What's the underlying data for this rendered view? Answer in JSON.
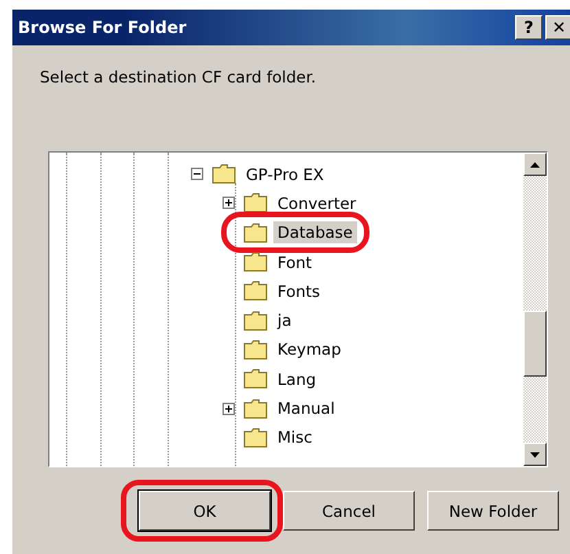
{
  "window": {
    "title": "Browse For Folder",
    "buttons": [
      "?",
      "✕"
    ]
  },
  "prompt": "Select a destination CF card folder.",
  "tree": [
    {
      "label": "GP-Pro EX",
      "has_children": true,
      "expanded": true,
      "selected": false,
      "highlighted": false,
      "children": [
        {
          "label": "Converter",
          "has_children": true,
          "expanded": false,
          "selected": false,
          "highlighted": false
        },
        {
          "label": "Database",
          "has_children": false,
          "expanded": false,
          "selected": true,
          "highlighted": true
        },
        {
          "label": "Font",
          "has_children": false,
          "expanded": false,
          "selected": false,
          "highlighted": false
        },
        {
          "label": "Fonts",
          "has_children": false,
          "expanded": false,
          "selected": false,
          "highlighted": false
        },
        {
          "label": "ja",
          "has_children": false,
          "expanded": false,
          "selected": false,
          "highlighted": false
        },
        {
          "label": "Keymap",
          "has_children": false,
          "expanded": false,
          "selected": false,
          "highlighted": false
        },
        {
          "label": "Lang",
          "has_children": false,
          "expanded": false,
          "selected": false,
          "highlighted": false
        },
        {
          "label": "Manual",
          "has_children": true,
          "expanded": false,
          "selected": false,
          "highlighted": false
        },
        {
          "label": "Misc",
          "has_children": false,
          "expanded": false,
          "selected": false,
          "highlighted": false
        }
      ]
    }
  ],
  "buttons": [
    {
      "label": "OK",
      "default": true,
      "highlighted": true
    },
    {
      "label": "Cancel",
      "default": false,
      "highlighted": false
    },
    {
      "label": "New Folder",
      "default": false,
      "highlighted": false
    }
  ]
}
